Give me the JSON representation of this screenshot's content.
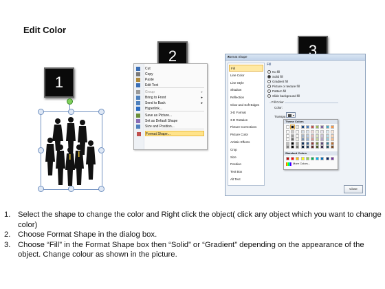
{
  "page": {
    "title": "Edit Color"
  },
  "badges": [
    "1",
    "2",
    "3"
  ],
  "context_menu": {
    "items": [
      {
        "label": "Cut",
        "icon": "scissors-icon"
      },
      {
        "label": "Copy",
        "icon": "copy-icon"
      },
      {
        "label": "Paste",
        "icon": "paste-icon"
      },
      {
        "label": "Edit Text",
        "icon": "edit-text-icon"
      },
      {
        "label": "Group",
        "icon": "group-icon",
        "disabled": true,
        "submenu": true
      },
      {
        "label": "Bring to Front",
        "icon": "bring-front-icon",
        "submenu": true
      },
      {
        "label": "Send to Back",
        "icon": "send-back-icon",
        "submenu": true
      },
      {
        "label": "Hyperlink...",
        "icon": "hyperlink-icon"
      },
      {
        "label": "Save as Picture...",
        "icon": "save-picture-icon"
      },
      {
        "label": "Set as Default Shape",
        "icon": "default-shape-icon"
      },
      {
        "label": "Size and Position...",
        "icon": "size-position-icon"
      },
      {
        "label": "Format Shape...",
        "icon": "format-shape-icon",
        "highlighted": true
      }
    ]
  },
  "format_dialog": {
    "title": "Format Shape",
    "help": "?",
    "close_x": "X",
    "nav": [
      "Fill",
      "Line Color",
      "Line Style",
      "Shadow",
      "Reflection",
      "Glow and Soft Edges",
      "3-D Format",
      "3-D Rotation",
      "Picture Corrections",
      "Picture Color",
      "Artistic Effects",
      "Crop",
      "Size",
      "Position",
      "Text Box",
      "Alt Text"
    ],
    "pane_title": "Fill",
    "fill_options": [
      {
        "label": "No fill",
        "selected": false
      },
      {
        "label": "Solid fill",
        "selected": true
      },
      {
        "label": "Gradient fill",
        "selected": false
      },
      {
        "label": "Picture or texture fill",
        "selected": false
      },
      {
        "label": "Pattern fill",
        "selected": false
      },
      {
        "label": "Slide background fill",
        "selected": false
      }
    ],
    "fill_color_group": "Fill Color",
    "color_label": "Color:",
    "transparency_label": "Transpa",
    "close_button": "Close",
    "palette": {
      "theme_header": "Theme Colors",
      "standard_header": "Standard Colors",
      "more_colors": "More Colors...",
      "theme_top": [
        "#ffffff",
        "#000000",
        "#eeece1",
        "#1f497d",
        "#4f81bd",
        "#c0504d",
        "#9bbb59",
        "#8064a2",
        "#4bacc6",
        "#f79646"
      ],
      "standard": [
        "#c00000",
        "#ff0000",
        "#ffc000",
        "#ffff00",
        "#92d050",
        "#00b050",
        "#00b0f0",
        "#0070c0",
        "#002060",
        "#7030a0"
      ]
    }
  },
  "steps": [
    {
      "num": "1.",
      "text": "Select the shape to change the color and Right click the object( click any object which you want to change color)"
    },
    {
      "num": "2.",
      "text": "Choose Format Shape in the dialog box."
    },
    {
      "num": "3.",
      "text": "Choose “Fill” in the Format Shape box then “Solid” or “Gradient” depending on the appearance of the object. Change colour as shown in the picture."
    }
  ]
}
